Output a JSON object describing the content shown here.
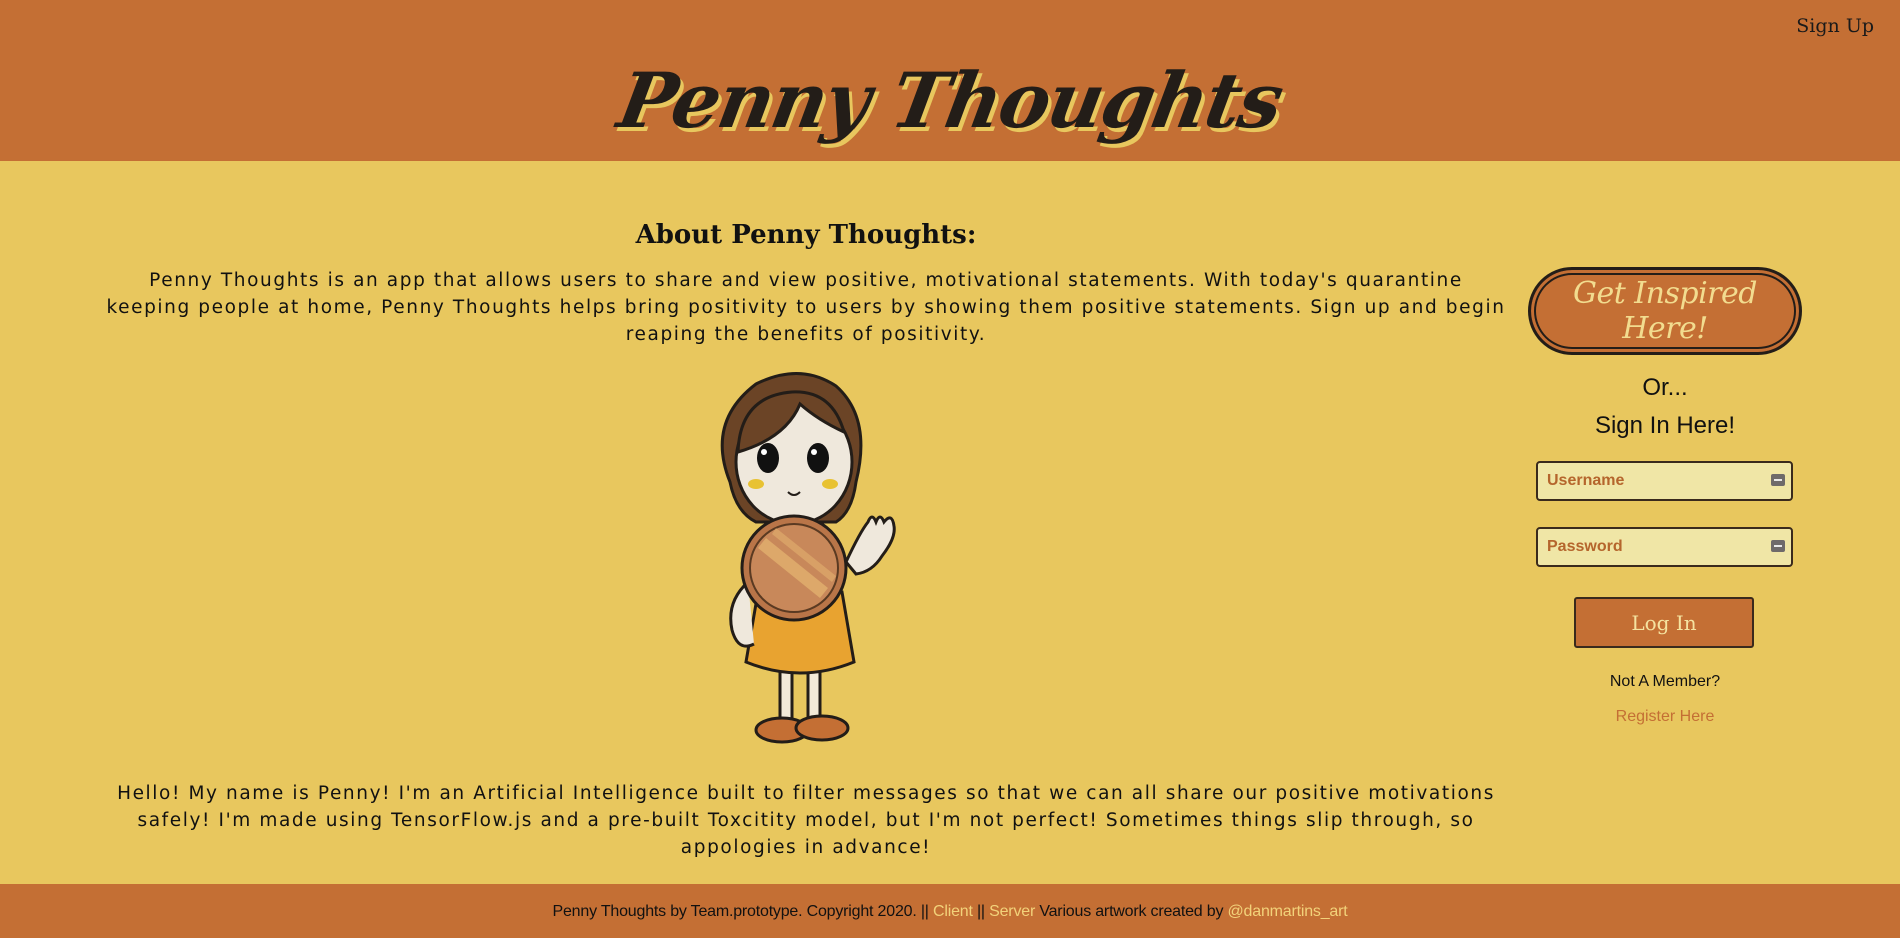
{
  "header": {
    "title": "Penny Thoughts",
    "signup_link": "Sign Up"
  },
  "about": {
    "title": "About Penny Thoughts:",
    "description": "Penny Thoughts is an app that allows users to share and view positive, motivational statements. With today's quarantine keeping people at home, Penny Thoughts helps bring positivity to users by showing them positive statements. Sign up and begin reaping the benefits of positivity.",
    "penny_intro": "Hello! My name is Penny! I'm an Artificial Intelligence built to filter messages so that we can all share our positive motivations safely! I'm made using TensorFlow.js and a pre-built Toxcitity model, but I'm not perfect! Sometimes things slip through, so appologies in advance!"
  },
  "sidebar": {
    "inspire_button": "Get Inspired Here!",
    "or_text": "Or...",
    "signin_title": "Sign In Here!",
    "username_placeholder": "Username",
    "password_placeholder": "Password",
    "login_button": "Log In",
    "not_member_text": "Not A Member?",
    "register_link": "Register Here"
  },
  "footer": {
    "credit_text": "Penny Thoughts by Team.prototype. Copyright 2020. ||",
    "client_link": "Client",
    "separator": "||",
    "server_link": "Server",
    "artwork_text": "Various artwork created by",
    "artist_link": "@danmartins_art"
  },
  "colors": {
    "header_bg": "#c46f34",
    "page_bg": "#e8c75e",
    "input_bg": "#f0e6a6",
    "link_light": "#f2d27a"
  }
}
